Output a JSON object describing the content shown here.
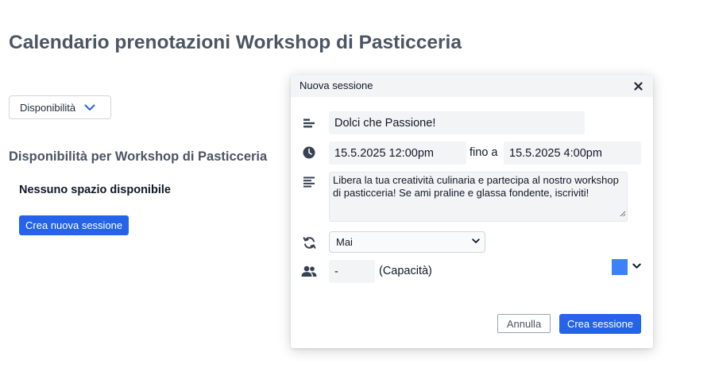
{
  "page": {
    "title": "Calendario prenotazioni Workshop di Pasticceria",
    "view_select": {
      "value": "Disponibilità",
      "icon": "chevron-down-icon"
    },
    "section_title": "Disponibilità per Workshop di Pasticceria",
    "empty_message": "Nessuno spazio disponibile",
    "create_button": "Crea nuova sessione"
  },
  "modal": {
    "title": "Nuova sessione",
    "close_icon": "close-icon",
    "name": {
      "icon": "title-icon",
      "value": "Dolci che Passione!"
    },
    "time": {
      "icon": "clock-icon",
      "start": "15.5.2025 12:00pm",
      "separator": "fino a",
      "end": "15.5.2025 4:00pm"
    },
    "description": {
      "icon": "description-icon",
      "value": "Libera la tua creatività culinaria e partecipa al nostro workshop di pasticceria! Se ami praline e glassa fondente, iscriviti!"
    },
    "repeat": {
      "icon": "repeat-icon",
      "value": "Mai"
    },
    "capacity": {
      "icon": "users-icon",
      "value": "-",
      "label": "(Capacità)"
    },
    "color": {
      "value": "#3b82f6"
    },
    "cancel_button": "Annulla",
    "submit_button": "Crea sessione"
  },
  "colors": {
    "primary": "#2563eb",
    "heading": "#4b5563",
    "field_background": "#f3f4f6",
    "accent_swatch": "#3b82f6"
  }
}
